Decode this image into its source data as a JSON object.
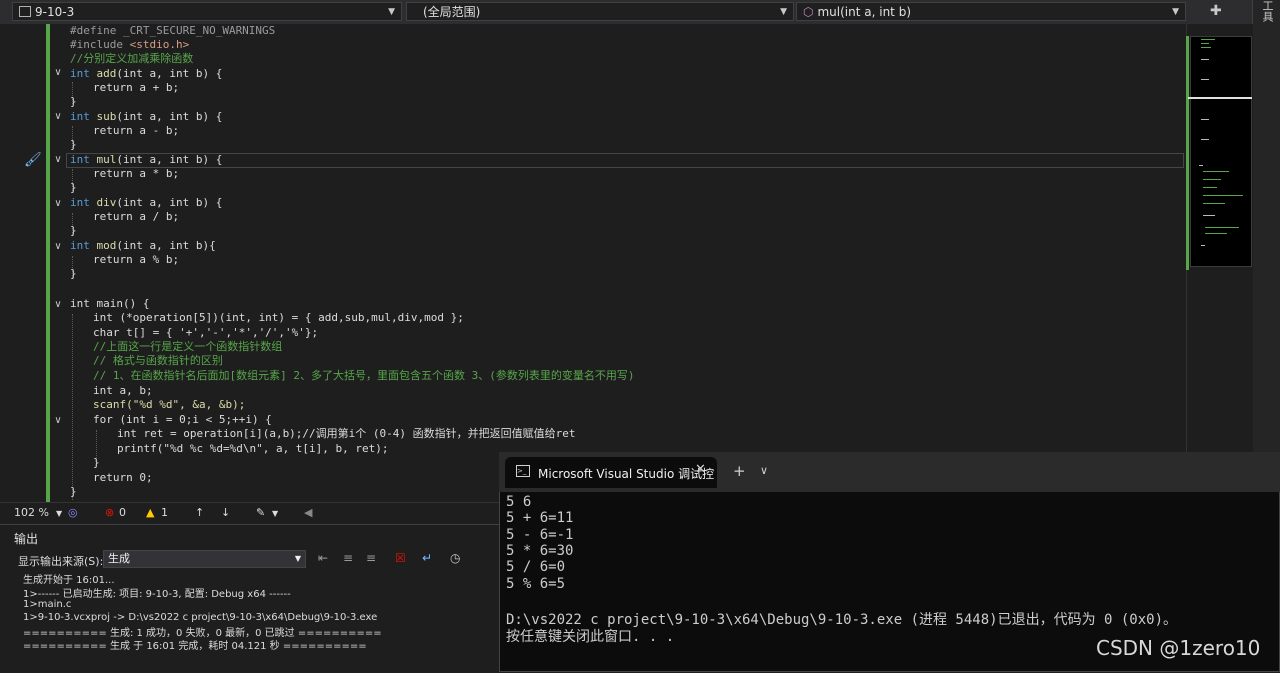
{
  "nav": {
    "project": "9-10-3",
    "scope": "(全局范围)",
    "function": "mul(int a, int b)",
    "pin_glyph": "⯁",
    "side_label": "工具"
  },
  "code": {
    "l1": "#define _CRT_SECURE_NO_WARNINGS",
    "l2a": "#include ",
    "l2b": "<stdio.h>",
    "l3": "//分别定义加减乘除函数",
    "fn_add": "add",
    "fn_sub": "sub",
    "fn_mul": "mul",
    "fn_div": "div",
    "fn_mod": "mod",
    "params": "(int a, int b)",
    "params_mod": "(int a, int b){",
    "ret_add": "return a + b;",
    "ret_sub": "return a - b;",
    "ret_mul": "return a * b;",
    "ret_div": "return a / b;",
    "ret_mod": "return a % b;",
    "main": "int main() {",
    "opdecl": "int (*operation[5])(int, int) = { add,sub,mul,div,mod };",
    "chardecl": "char t[] = { '+','-','*','/','%'};",
    "c1": "//上面这一行是定义一个函数指针数组",
    "c2": "// 格式与函数指针的区别",
    "c3": "// 1、在函数指针名后面加[数组元素] 2、多了大括号，里面包含五个函数 3、(参数列表里的变量名不用写)",
    "intab": "int a, b;",
    "scanf": "scanf(\"%d %d\", &a, &b);",
    "for": "for (int i = 0;i < 5;++i) {",
    "ret_line": "int ret = operation[i](a,b);//调用第i个 (0-4) 函数指针，并把返回值赋值给ret",
    "printf": "printf(\"%d %c %d=%d\\n\", a, t[i], b, ret);",
    "close": "}",
    "ret0": "return 0;"
  },
  "status": {
    "zoom": "102 %",
    "errors": "0",
    "warnings": "1"
  },
  "output": {
    "title": "输出",
    "show_from": "显示输出来源(S):",
    "source": "生成",
    "lines": [
      "生成开始于 16:01...",
      "1>------ 已启动生成: 项目: 9-10-3, 配置: Debug x64 ------",
      "1>main.c",
      "1>9-10-3.vcxproj -> D:\\vs2022 c project\\9-10-3\\x64\\Debug\\9-10-3.exe",
      "========== 生成: 1 成功，0 失败，0 最新，0 已跳过 ==========",
      "========== 生成 于 16:01 完成，耗时 04.121 秒 =========="
    ]
  },
  "terminal": {
    "tab_title": "Microsoft Visual Studio 调试控",
    "lines": [
      "5 6",
      "5 + 6=11",
      "5 - 6=-1",
      "5 * 6=30",
      "5 / 6=0",
      "5 % 6=5",
      "",
      "D:\\vs2022 c project\\9-10-3\\x64\\Debug\\9-10-3.exe (进程 5448)已退出，代码为 0 (0x0)。",
      "按任意键关闭此窗口. . ."
    ]
  },
  "watermark": "CSDN @1zero10"
}
